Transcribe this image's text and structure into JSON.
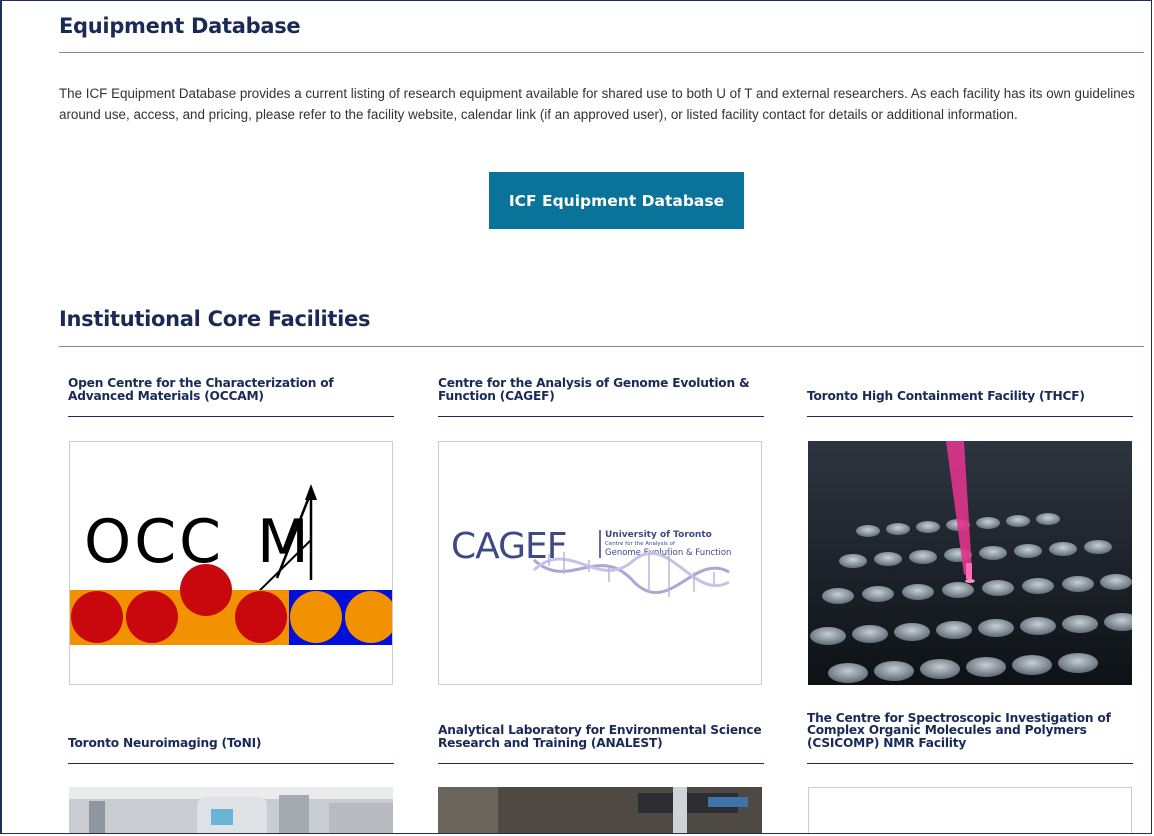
{
  "equipment": {
    "heading": "Equipment Database",
    "intro": "The ICF Equipment Database provides a current listing of research equipment available for shared use to both U of T and external researchers. As each facility has its own guidelines around use, access, and pricing, please refer to the facility website, calendar link (if an approved user), or listed facility contact for details or additional information.",
    "button_label": "ICF Equipment Database"
  },
  "icf": {
    "heading": "Institutional Core Facilities",
    "cards": [
      {
        "title": "Open Centre for the Characterization of Advanced Materials (OCCAM)"
      },
      {
        "title": "Centre for the Analysis of Genome Evolution & Function (CAGEF)"
      },
      {
        "title": "Toronto High Containment Facility (THCF)"
      },
      {
        "title": "Toronto Neuroimaging (ToNI)"
      },
      {
        "title": "Analytical Laboratory for Environmental Science Research and Training (ANALEST)"
      },
      {
        "title": "The Centre for Spectroscopic Investigation of Complex Organic Molecules and Polymers (CSICOMP) NMR Facility"
      }
    ]
  },
  "logos": {
    "occam_text": "OCC M",
    "cagef_text": "CAGEF",
    "cagef_university": "University of Toronto",
    "cagef_small": "Centre for the Analysis of",
    "cagef_full": "Genome Evolution & Function"
  },
  "colors": {
    "heading": "#1a2a57",
    "button": "#0a739a",
    "occam_orange": "#f39200",
    "occam_red": "#c8080d",
    "occam_blue": "#0010d8"
  }
}
